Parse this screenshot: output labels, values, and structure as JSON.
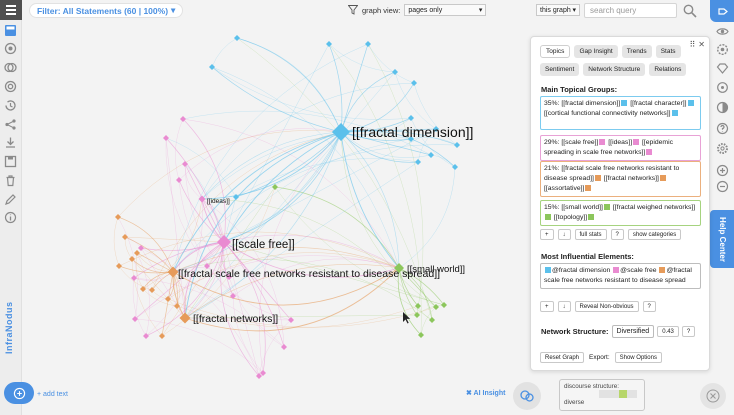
{
  "toolbar": {
    "filter_label": "Filter: All Statements (60 | 100%)",
    "graph_view_label": "graph view:",
    "graph_view_value": "pages only",
    "scope_value": "this graph",
    "search_placeholder": "search query"
  },
  "brand": {
    "name": "InfraNodus"
  },
  "help_center": "Help Center",
  "graph": {
    "colors": {
      "blue": "#5bc0eb",
      "pink": "#e98bd1",
      "orange": "#e69b5a",
      "green": "#8cc65c"
    },
    "labels": {
      "fractal_dimension": "[[fractal dimension]]",
      "scale_free": "[[scale free]]",
      "resistant": "[[fractal scale free networks resistant to disease spread]]",
      "small_world": "[[small world]]",
      "fractal_networks": "[[fractal networks]]",
      "ideas": "[[ideas]]"
    }
  },
  "panel": {
    "tabs_row1": [
      "Topics",
      "Gap Insight",
      "Trends",
      "Stats"
    ],
    "tabs_row2": [
      "Sentiment",
      "Network Structure",
      "Relations"
    ],
    "topics_title": "Main Topical Groups:",
    "topics": [
      {
        "parts": [
          "35%: [[fractal dimension]]",
          "[[fractal character]]",
          "[[cortical functional connectivity networks]]"
        ],
        "color": "#5bc0eb",
        "border": "#7ccbef"
      },
      {
        "parts": [
          "29%: [[scale free]]",
          "[[ideas]]",
          "[[epidemic spreading in scale free networks]]"
        ],
        "color": "#e98bd1",
        "border": "#e8a2d6"
      },
      {
        "parts": [
          "21%: [[fractal scale free networks resistant to disease spread]]",
          "[[fractal networks]]",
          "[[assortative]]"
        ],
        "color": "#e69b5a",
        "border": "#ebb07e"
      },
      {
        "parts": [
          "15%: [[small world]]",
          "[[fractal weighed networks]]",
          "[[topology]]"
        ],
        "color": "#8cc65c",
        "border": "#a6d37f"
      }
    ],
    "topic_buttons": [
      "+",
      "↓",
      "full stats",
      "?",
      "show categories"
    ],
    "influential_title": "Most Influential Elements:",
    "influential": [
      {
        "text": "@fractal dimension",
        "color": "#5bc0eb"
      },
      {
        "text": "@scale free",
        "color": "#e98bd1"
      },
      {
        "text": "@fractal scale free networks resistant to disease spread",
        "color": "#e69b5a"
      }
    ],
    "influence_buttons": [
      "+",
      "↓",
      "Reveal Non-obvious",
      "?"
    ],
    "structure_label": "Network Structure:",
    "structure_value": "Diversified",
    "modularity": "0.43",
    "structure_help": "?",
    "reset_label": "Reset Graph",
    "export_label": "Export:",
    "show_options_label": "Show Options"
  },
  "bottom": {
    "add_text_label": "+ add text",
    "ai_insight_label": "✖ AI Insight",
    "discourse_label": "discourse structure:",
    "discourse_value": "diverse"
  }
}
